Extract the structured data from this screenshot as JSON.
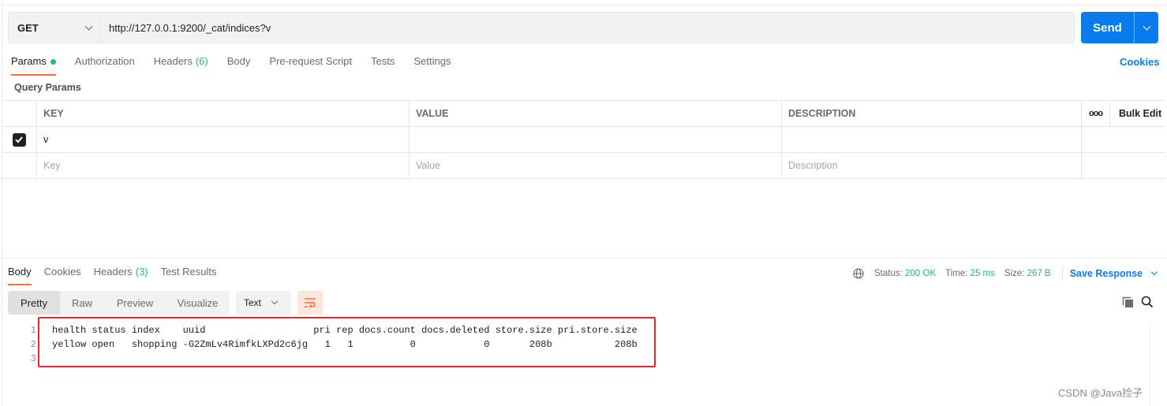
{
  "request": {
    "method": "GET",
    "url": "http://127.0.0.1:9200/_cat/indices?v",
    "send_label": "Send"
  },
  "request_tabs": [
    {
      "label": "Params",
      "active": true,
      "indicator": "green-dot"
    },
    {
      "label": "Authorization"
    },
    {
      "label": "Headers",
      "count": "(6)"
    },
    {
      "label": "Body"
    },
    {
      "label": "Pre-request Script"
    },
    {
      "label": "Tests"
    },
    {
      "label": "Settings"
    }
  ],
  "cookies_label": "Cookies",
  "query_params": {
    "title": "Query Params",
    "columns": [
      "KEY",
      "VALUE",
      "DESCRIPTION"
    ],
    "more_icon": "ooo",
    "bulk_edit_label": "Bulk Edit",
    "rows": [
      {
        "checked": true,
        "key": "v",
        "value": "",
        "description": ""
      }
    ],
    "placeholders": {
      "key": "Key",
      "value": "Value",
      "description": "Description"
    }
  },
  "response_tabs": [
    {
      "label": "Body",
      "active": true
    },
    {
      "label": "Cookies"
    },
    {
      "label": "Headers",
      "count": "(3)"
    },
    {
      "label": "Test Results"
    }
  ],
  "response_status": {
    "status_label": "Status:",
    "status_value": "200 OK",
    "time_label": "Time:",
    "time_value": "25 ms",
    "size_label": "Size:",
    "size_value": "267 B",
    "save_label": "Save Response"
  },
  "view_modes": [
    "Pretty",
    "Raw",
    "Preview",
    "Visualize"
  ],
  "active_view": "Pretty",
  "format": "Text",
  "response_body": {
    "lines": [
      {
        "num": "1",
        "text": "health status index    uuid                   pri rep docs.count docs.deleted store.size pri.store.size"
      },
      {
        "num": "2",
        "text": "yellow open   shopping -G2ZmLv4RimfkLXPd2c6jg   1   1          0            0       208b           208b"
      },
      {
        "num": "3",
        "text": ""
      }
    ]
  },
  "colors": {
    "accent": "#097bed",
    "active_tab": "#ff6c37",
    "success": "#26b47f",
    "highlight": "#e8262b"
  },
  "watermark": "CSDN @Java捡子"
}
